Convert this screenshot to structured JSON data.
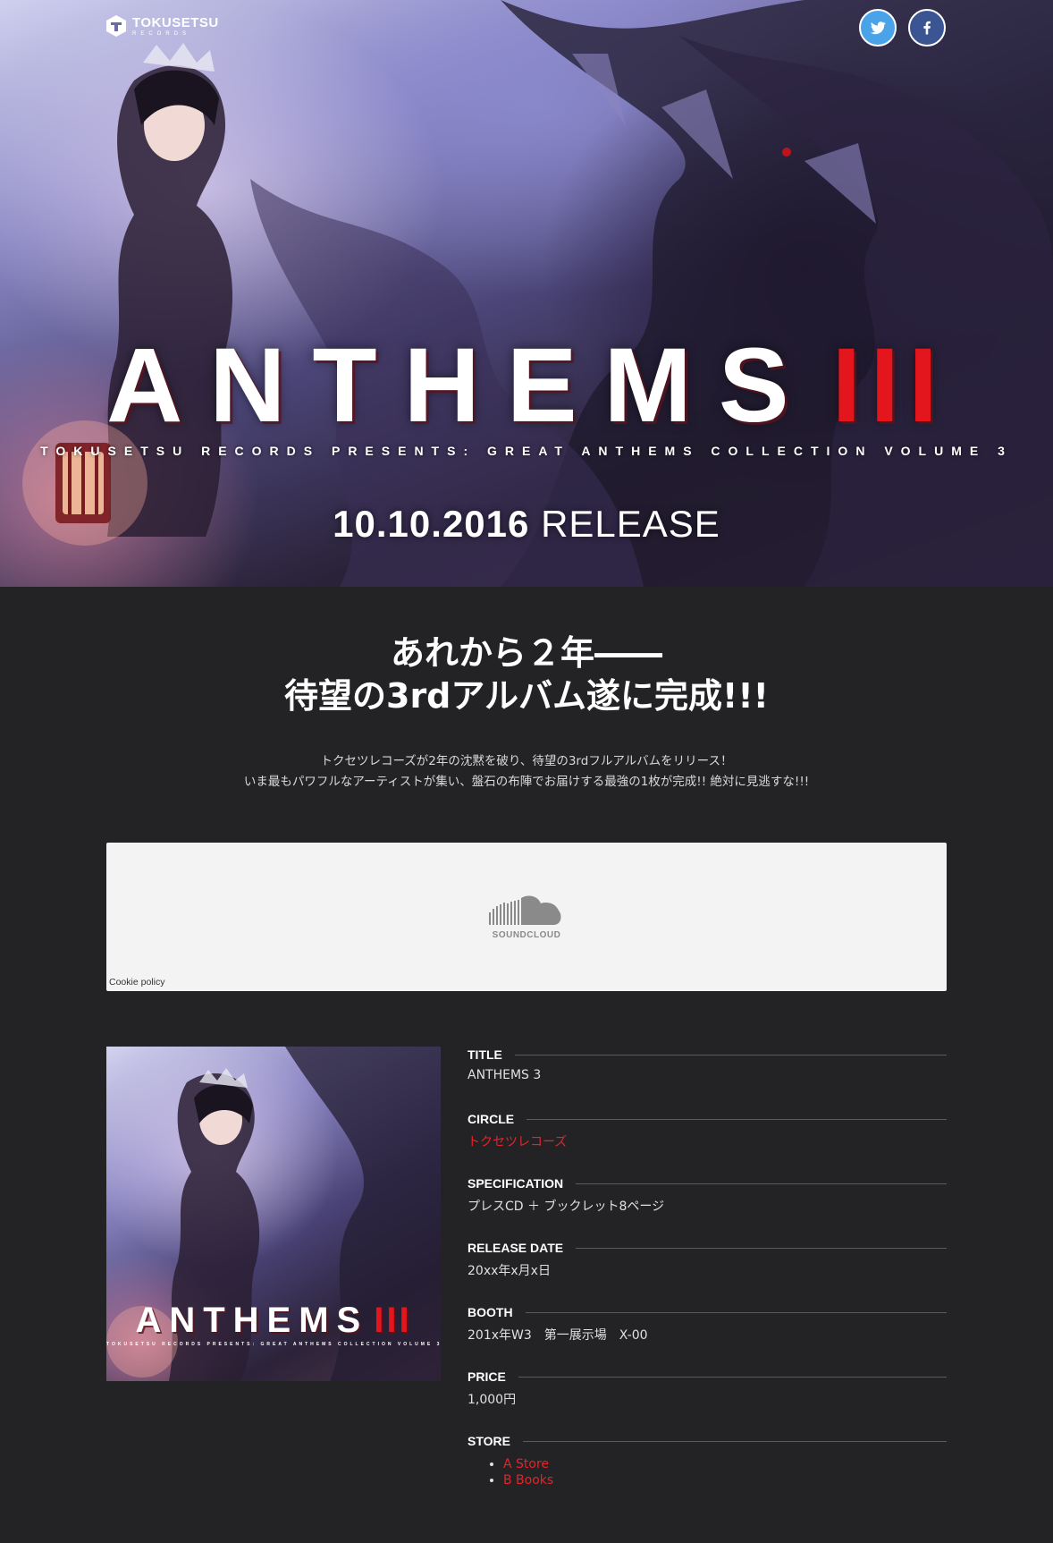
{
  "header": {
    "logo_name": "TOKUSETSU",
    "logo_sub": "RECORDS",
    "social": [
      {
        "name": "twitter",
        "color": "#4aa3e8"
      },
      {
        "name": "facebook",
        "color": "#3a5591"
      }
    ]
  },
  "hero": {
    "title": "ANTHEMS",
    "volume": "III",
    "subtitle": "TOKUSETSU RECORDS PRESENTS: GREAT ANTHEMS COLLECTION VOLUME 3",
    "release_date": "10.10.2016",
    "release_word": "RELEASE"
  },
  "intro": {
    "headline_line1": "あれから２年――",
    "headline_line2": "待望の3rdアルバム遂に完成!!!",
    "lead_line1": "トクセツレコーズが2年の沈黙を破り、待望の3rdフルアルバムをリリース！",
    "lead_line2": "いま最もパワフルなアーティストが集い、盤石の布陣でお届けする最強の1枚が完成!! 絶対に見逃すな!!!"
  },
  "player": {
    "brand": "SOUNDCLOUD",
    "cookie_policy": "Cookie policy"
  },
  "cover": {
    "title": "ANTHEMS",
    "volume": "III",
    "subtitle": "TOKUSETSU RECORDS PRESENTS: GREAT ANTHEMS COLLECTION VOLUME 3"
  },
  "details": {
    "title_label": "TITLE",
    "title_value": "ANTHEMS 3",
    "circle_label": "CIRCLE",
    "circle_value": "トクセツレコーズ",
    "spec_label": "SPECIFICATION",
    "spec_value": "プレスCD ＋ ブックレット8ページ",
    "release_label": "RELEASE DATE",
    "release_value": "20xx年x月x日",
    "booth_label": "BOOTH",
    "booth_value": "201x年W3　第一展示場　X-00",
    "price_label": "PRICE",
    "price_value": "1,000円",
    "store_label": "STORE",
    "stores": [
      "A Store",
      "B Books"
    ]
  },
  "colors": {
    "background": "#232325",
    "accent_red": "#e3242b",
    "player_bg": "#f3f3f3"
  }
}
